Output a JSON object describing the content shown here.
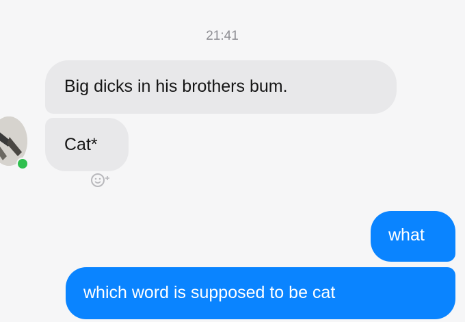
{
  "thread": {
    "timestamp": "21:41",
    "messages": [
      {
        "from": "contact",
        "text": "Big dicks in his brothers bum."
      },
      {
        "from": "contact",
        "text": "Cat*"
      },
      {
        "from": "me",
        "text": "what"
      },
      {
        "from": "me",
        "text": "which word is supposed to be cat"
      }
    ]
  },
  "contact": {
    "status": "online"
  },
  "colors": {
    "incoming_bubble": "#e8e8ea",
    "outgoing_bubble": "#0a84ff",
    "online_indicator": "#2fbf4f",
    "background": "#f6f6f7"
  },
  "icons": {
    "reaction": "add-reaction-icon"
  }
}
